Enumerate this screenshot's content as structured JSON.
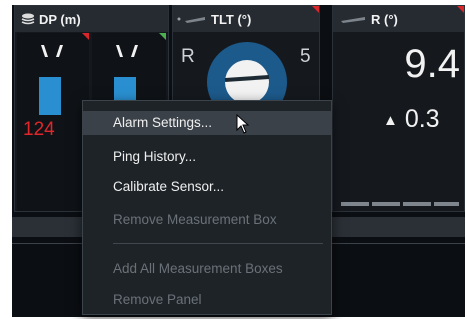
{
  "panels": [
    {
      "title": "DP (m)",
      "value": "124",
      "icon": "layers-icon"
    },
    {
      "title": "TLT (°)",
      "left_label": "R",
      "right_label": "5",
      "icon": "sensor-icon"
    },
    {
      "title": "R (°)",
      "value": "9.4",
      "delta": "0.3",
      "delta_arrow": "▲",
      "icon": "sensor-icon"
    }
  ],
  "context_menu": {
    "items": [
      {
        "label": "Alarm Settings...",
        "enabled": true,
        "hovered": true
      },
      {
        "label": "Ping History...",
        "enabled": true
      },
      {
        "label": "Calibrate Sensor...",
        "enabled": true
      },
      {
        "label": "Remove Measurement Box",
        "enabled": false
      },
      {
        "label": "Add All Measurement Boxes",
        "enabled": false
      },
      {
        "label": "Remove Panel",
        "enabled": false
      }
    ]
  },
  "colors": {
    "alarm_red": "#d8262b",
    "ok_green": "#4caf50",
    "bar_blue": "#2a8fd0",
    "value_red": "#e0262b"
  }
}
